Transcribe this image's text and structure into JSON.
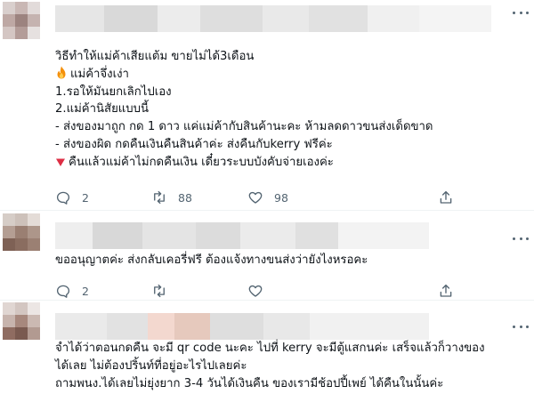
{
  "colors": {
    "text": "#0f1419",
    "muted": "#536471",
    "divider": "#eff3f4",
    "fire": "#f4900c",
    "triangle": "#dd2e44"
  },
  "tweets": [
    {
      "lines": [
        "วิธีทำให้แม่ค้าเสียแต้ม ขายไม่ได้3เดือน",
        "แม่ค้าจึ่งเง่า",
        "1.รอให้มันยกเลิกไปเอง",
        "2.แม่ค้านิสัยแบบนี้",
        "- ส่งของมาถูก กด 1 ดาว แค่แม่ค้ากับสินค้านะคะ ห้ามลดดาวขนส่งเด็ดขาด",
        "- ส่งของผิด กดคืนเงินคืนสินค้าค่ะ ส่งคืนกับkerry ฟรีค่ะ",
        "คืนแล้วแม่ค้าไม่กดคืนเงิน เดี๋ยวระบบบังคับจ่ายเองค่ะ"
      ],
      "line_icons": [
        "",
        "fire-icon",
        "",
        "",
        "",
        "",
        "red-triangle-down-icon"
      ],
      "reply_count": "2",
      "retweet_count": "88",
      "like_count": "98"
    },
    {
      "lines": [
        "ขออนุญาตค่ะ ส่งกลับเคอรี่ฟรี ต้องแจ้งทางขนส่งว่ายังไงหรอคะ"
      ],
      "reply_count": "2",
      "retweet_count": "",
      "like_count": ""
    },
    {
      "lines": [
        "จำได้ว่าตอนกดคืน จะมี qr code นะคะ ไปที่ kerry จะมีตู้แสกนค่ะ เสร็จแล้วก็วางของ",
        "ได้เลย ไม่ต้องปริ้นท์ที่อยู่อะไรไปเลยค่ะ",
        "ถามพนง.ได้เลยไม่ยุ่งยาก  3-4 วันได้เงินคืน ของเรามีช้อปปี้เพย์ ได้คืนในนั้นค่ะ"
      ]
    }
  ]
}
